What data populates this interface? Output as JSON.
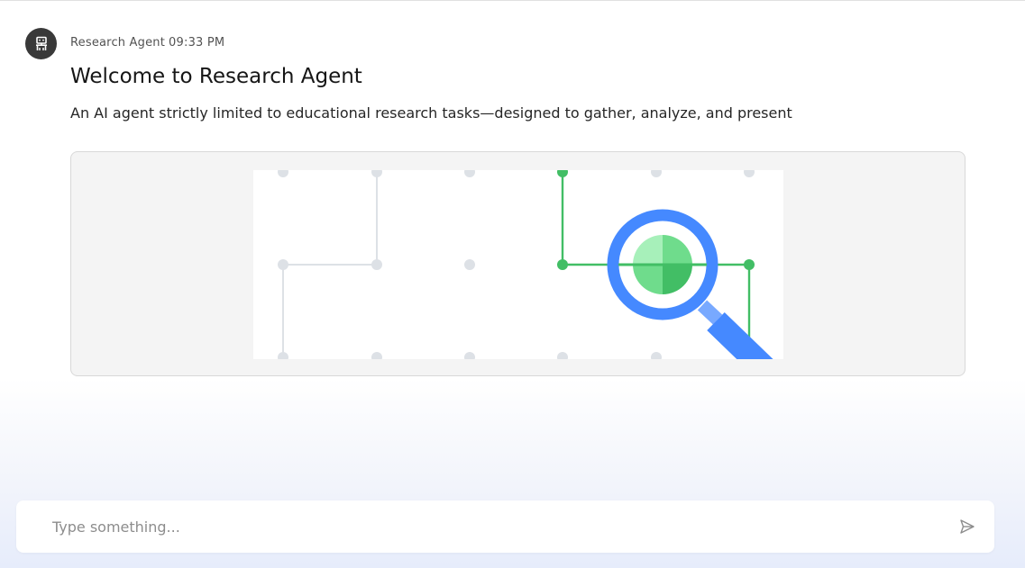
{
  "message": {
    "avatar_icon": "robot-icon",
    "sender": "Research Agent",
    "time": "09:33 PM",
    "title": "Welcome to Research Agent",
    "description": "An AI agent strictly limited to educational research tasks—designed to gather, analyze, and present",
    "image": {
      "icon": "magnifier-network-illustration",
      "colors": {
        "grid": "#dde1e6",
        "path": "#42be65",
        "lens": "#4589ff",
        "lens_inner": "#6fdc8c"
      }
    }
  },
  "composer": {
    "placeholder": "Type something...",
    "value": "",
    "send_icon": "send-icon"
  }
}
